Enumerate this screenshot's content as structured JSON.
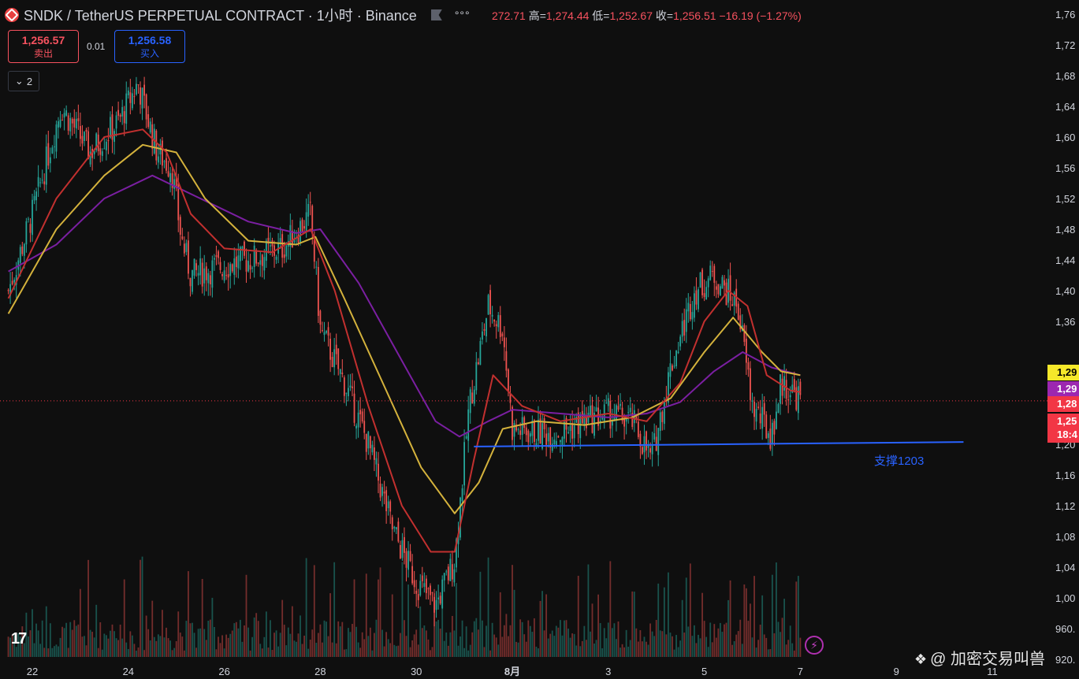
{
  "header": {
    "title": "SNDK / TetherUS PERPETUAL CONTRACT · 1小时 · Binance",
    "ohlc": [
      {
        "label": "",
        "value": "272.71"
      },
      {
        "label": "高=",
        "value": "1,274.44"
      },
      {
        "label": "低=",
        "value": "1,252.67"
      },
      {
        "label": "收=",
        "value": "1,256.51"
      },
      {
        "label": "",
        "value": "−16.19 (−1.27%)"
      }
    ]
  },
  "trade": {
    "sell_price": "1,256.57",
    "sell_label": "卖出",
    "spread": "0.01",
    "buy_price": "1,256.58",
    "buy_label": "买入"
  },
  "indicators_count": "2",
  "price_tags": [
    {
      "text": "1,29",
      "price": 1293,
      "bg": "#f5e82a",
      "fg": "#000000"
    },
    {
      "text": "1,29",
      "price": 1272,
      "bg": "#9c27b0",
      "fg": "#ffffff"
    },
    {
      "text": "1,28",
      "price": 1252,
      "bg": "#f23645",
      "fg": "#ffffff"
    },
    {
      "text": "1,25",
      "price": 1230,
      "bg": "#f23645",
      "fg": "#ffffff"
    },
    {
      "text": "18:4",
      "price": 1212,
      "bg": "#f23645",
      "fg": "#ffffff"
    }
  ],
  "support": {
    "label": "支撑1203",
    "price_start": 1197,
    "price_end": 1203,
    "color": "#2962ff"
  },
  "watermark": "@ 加密交易叫兽",
  "colors": {
    "up": "#26a69a",
    "down": "#ef5350",
    "ma_fast": "#c2302f",
    "ma_mid": "#d4b23c",
    "ma_slow": "#7b1fa2"
  },
  "chart_data": {
    "type": "candlestick",
    "title": "SNDK / TetherUS PERPETUAL CONTRACT · 1小时 · Binance",
    "x_ticks": [
      "22",
      "24",
      "26",
      "28",
      "30",
      "8月",
      "3",
      "5",
      "7",
      "9",
      "11"
    ],
    "y_ticks": [
      "1,76",
      "1,72",
      "1,68",
      "1,64",
      "1,60",
      "1,56",
      "1,52",
      "1,48",
      "1,44",
      "1,40",
      "1,36",
      "1,20",
      "1,16",
      "1,12",
      "1,08",
      "1,04",
      "1,00",
      "960.",
      "920."
    ],
    "ylim": [
      920,
      1760
    ],
    "last_price": 1256.51,
    "close_path": [
      {
        "x": 21.5,
        "y": 1400
      },
      {
        "x": 22,
        "y": 1500
      },
      {
        "x": 22.6,
        "y": 1640
      },
      {
        "x": 23.2,
        "y": 1580
      },
      {
        "x": 23.8,
        "y": 1620
      },
      {
        "x": 24.2,
        "y": 1670
      },
      {
        "x": 24.6,
        "y": 1580
      },
      {
        "x": 24.9,
        "y": 1560
      },
      {
        "x": 25.1,
        "y": 1470
      },
      {
        "x": 25.3,
        "y": 1420
      },
      {
        "x": 25.8,
        "y": 1430
      },
      {
        "x": 26.5,
        "y": 1440
      },
      {
        "x": 27.2,
        "y": 1455
      },
      {
        "x": 27.8,
        "y": 1500
      },
      {
        "x": 28,
        "y": 1350
      },
      {
        "x": 28.5,
        "y": 1280
      },
      {
        "x": 29,
        "y": 1200
      },
      {
        "x": 29.5,
        "y": 1090
      },
      {
        "x": 30,
        "y": 1020
      },
      {
        "x": 30.4,
        "y": 990
      },
      {
        "x": 30.8,
        "y": 1050
      },
      {
        "x": 31.1,
        "y": 1250
      },
      {
        "x": 31.5,
        "y": 1380
      },
      {
        "x": 31.8,
        "y": 1350
      },
      {
        "x": 32.0,
        "y": 1220
      },
      {
        "x": 32.5,
        "y": 1215
      },
      {
        "x": 33.0,
        "y": 1215
      },
      {
        "x": 33.5,
        "y": 1230
      },
      {
        "x": 34.0,
        "y": 1240
      },
      {
        "x": 34.5,
        "y": 1230
      },
      {
        "x": 34.9,
        "y": 1180
      },
      {
        "x": 35.3,
        "y": 1300
      },
      {
        "x": 35.8,
        "y": 1400
      },
      {
        "x": 36.2,
        "y": 1420
      },
      {
        "x": 36.7,
        "y": 1380
      },
      {
        "x": 37.0,
        "y": 1250
      },
      {
        "x": 37.4,
        "y": 1210
      },
      {
        "x": 37.6,
        "y": 1280
      },
      {
        "x": 38.0,
        "y": 1260
      }
    ],
    "ma_fast": [
      {
        "x": 21.5,
        "y": 1390
      },
      {
        "x": 22.5,
        "y": 1520
      },
      {
        "x": 23.5,
        "y": 1600
      },
      {
        "x": 24.3,
        "y": 1610
      },
      {
        "x": 24.8,
        "y": 1580
      },
      {
        "x": 25.3,
        "y": 1500
      },
      {
        "x": 26,
        "y": 1455
      },
      {
        "x": 27,
        "y": 1450
      },
      {
        "x": 27.8,
        "y": 1480
      },
      {
        "x": 28.3,
        "y": 1400
      },
      {
        "x": 29,
        "y": 1250
      },
      {
        "x": 29.7,
        "y": 1120
      },
      {
        "x": 30.3,
        "y": 1060
      },
      {
        "x": 30.8,
        "y": 1060
      },
      {
        "x": 31.2,
        "y": 1180
      },
      {
        "x": 31.6,
        "y": 1290
      },
      {
        "x": 32.2,
        "y": 1250
      },
      {
        "x": 33,
        "y": 1230
      },
      {
        "x": 34,
        "y": 1240
      },
      {
        "x": 34.8,
        "y": 1230
      },
      {
        "x": 35.5,
        "y": 1280
      },
      {
        "x": 36.0,
        "y": 1360
      },
      {
        "x": 36.5,
        "y": 1400
      },
      {
        "x": 36.9,
        "y": 1380
      },
      {
        "x": 37.3,
        "y": 1290
      },
      {
        "x": 37.8,
        "y": 1270
      },
      {
        "x": 38.0,
        "y": 1268
      }
    ],
    "ma_mid": [
      {
        "x": 21.5,
        "y": 1370
      },
      {
        "x": 22.5,
        "y": 1480
      },
      {
        "x": 23.5,
        "y": 1550
      },
      {
        "x": 24.3,
        "y": 1590
      },
      {
        "x": 25,
        "y": 1580
      },
      {
        "x": 25.6,
        "y": 1520
      },
      {
        "x": 26.5,
        "y": 1465
      },
      {
        "x": 27.5,
        "y": 1460
      },
      {
        "x": 27.9,
        "y": 1470
      },
      {
        "x": 28.5,
        "y": 1390
      },
      {
        "x": 29.3,
        "y": 1280
      },
      {
        "x": 30.1,
        "y": 1170
      },
      {
        "x": 30.8,
        "y": 1110
      },
      {
        "x": 31.3,
        "y": 1150
      },
      {
        "x": 31.8,
        "y": 1220
      },
      {
        "x": 32.5,
        "y": 1230
      },
      {
        "x": 33.5,
        "y": 1225
      },
      {
        "x": 34.5,
        "y": 1235
      },
      {
        "x": 35.3,
        "y": 1260
      },
      {
        "x": 36.0,
        "y": 1320
      },
      {
        "x": 36.6,
        "y": 1365
      },
      {
        "x": 37.2,
        "y": 1320
      },
      {
        "x": 37.6,
        "y": 1295
      },
      {
        "x": 38.0,
        "y": 1290
      }
    ],
    "ma_slow": [
      {
        "x": 21.5,
        "y": 1425
      },
      {
        "x": 22.5,
        "y": 1460
      },
      {
        "x": 23.5,
        "y": 1520
      },
      {
        "x": 24.5,
        "y": 1550
      },
      {
        "x": 25.5,
        "y": 1520
      },
      {
        "x": 26.5,
        "y": 1490
      },
      {
        "x": 27.5,
        "y": 1475
      },
      {
        "x": 28,
        "y": 1480
      },
      {
        "x": 28.8,
        "y": 1410
      },
      {
        "x": 29.6,
        "y": 1320
      },
      {
        "x": 30.4,
        "y": 1230
      },
      {
        "x": 30.9,
        "y": 1210
      },
      {
        "x": 31.5,
        "y": 1230
      },
      {
        "x": 32.0,
        "y": 1245
      },
      {
        "x": 33,
        "y": 1240
      },
      {
        "x": 34.0,
        "y": 1235
      },
      {
        "x": 34.8,
        "y": 1240
      },
      {
        "x": 35.5,
        "y": 1255
      },
      {
        "x": 36.2,
        "y": 1295
      },
      {
        "x": 36.8,
        "y": 1320
      },
      {
        "x": 37.4,
        "y": 1300
      },
      {
        "x": 38.0,
        "y": 1290
      }
    ]
  }
}
